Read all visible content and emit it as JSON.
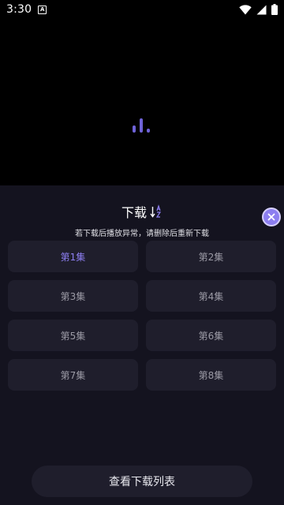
{
  "status_bar": {
    "time": "3:30",
    "notif_glyph": "A"
  },
  "sheet": {
    "title": "下载",
    "hint": "若下载后播放异常，请删除后重新下载",
    "episodes": [
      "第1集",
      "第2集",
      "第3集",
      "第4集",
      "第5集",
      "第6集",
      "第7集",
      "第8集"
    ],
    "active_episode_index": 0,
    "view_list_label": "查看下载列表"
  },
  "icons": {
    "loading": "loading-bars-icon",
    "sort": "sort-az-icon",
    "close": "close-icon",
    "wifi": "wifi-icon",
    "signal": "cell-signal-icon",
    "battery": "battery-icon"
  },
  "colors": {
    "accent": "#8c7ef0",
    "sheet_bg": "#14131f",
    "tile_bg": "#1f1e2c"
  }
}
